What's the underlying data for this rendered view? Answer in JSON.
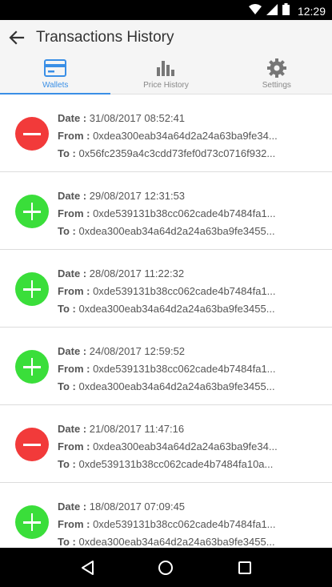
{
  "status_bar": {
    "time": "12:29"
  },
  "app_bar": {
    "title": "Transactions History"
  },
  "tabs": [
    {
      "label": "Wallets",
      "icon": "wallet-card-icon",
      "active": true
    },
    {
      "label": "Price History",
      "icon": "bar-chart-icon",
      "active": false
    },
    {
      "label": "Settings",
      "icon": "gear-icon",
      "active": false
    }
  ],
  "labels": {
    "date": "Date :",
    "from": "From :",
    "to": "To :"
  },
  "colors": {
    "accent": "#3a8fe6",
    "outgoing": "#f23a3a",
    "incoming": "#3ade3a"
  },
  "transactions": [
    {
      "direction": "out",
      "icon": "minus-icon",
      "date": "31/08/2017 08:52:41",
      "from": "0xdea300eab34a64d2a24a63ba9fe34...",
      "to": "0x56fc2359a4c3cdd73fef0d73c0716f932..."
    },
    {
      "direction": "in",
      "icon": "plus-icon",
      "date": "29/08/2017 12:31:53",
      "from": "0xde539131b38cc062cade4b7484fa1...",
      "to": "0xdea300eab34a64d2a24a63ba9fe3455..."
    },
    {
      "direction": "in",
      "icon": "plus-icon",
      "date": "28/08/2017 11:22:32",
      "from": "0xde539131b38cc062cade4b7484fa1...",
      "to": "0xdea300eab34a64d2a24a63ba9fe3455..."
    },
    {
      "direction": "in",
      "icon": "plus-icon",
      "date": "24/08/2017 12:59:52",
      "from": "0xde539131b38cc062cade4b7484fa1...",
      "to": "0xdea300eab34a64d2a24a63ba9fe3455..."
    },
    {
      "direction": "out",
      "icon": "minus-icon",
      "date": "21/08/2017 11:47:16",
      "from": "0xdea300eab34a64d2a24a63ba9fe34...",
      "to": "0xde539131b38cc062cade4b7484fa10a..."
    },
    {
      "direction": "in",
      "icon": "plus-icon",
      "date": "18/08/2017 07:09:45",
      "from": "0xde539131b38cc062cade4b7484fa1...",
      "to": "0xdea300eab34a64d2a24a63ba9fe3455..."
    }
  ]
}
